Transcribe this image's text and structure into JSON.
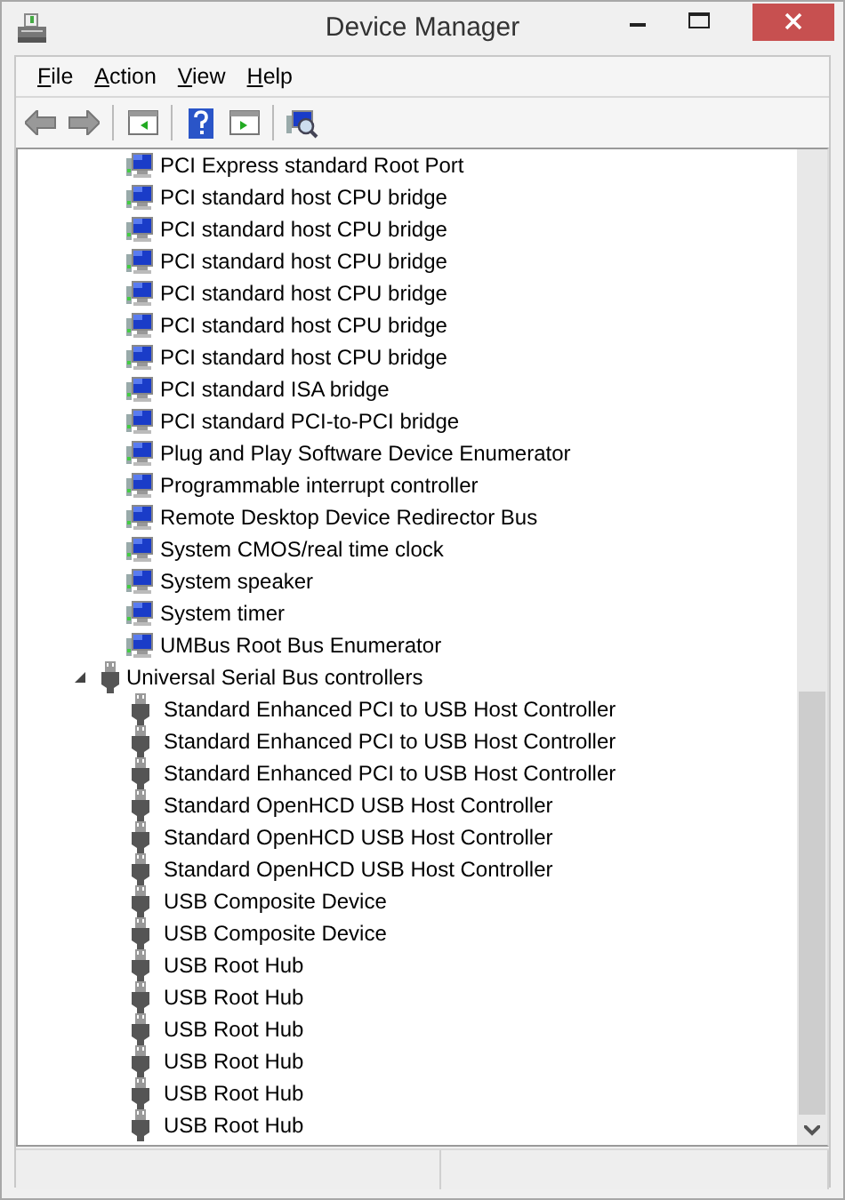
{
  "window": {
    "title": "Device Manager"
  },
  "menu": [
    "File",
    "Action",
    "View",
    "Help"
  ],
  "toolbar": [
    {
      "kind": "back"
    },
    {
      "kind": "forward"
    },
    {
      "kind": "separator"
    },
    {
      "kind": "console-tree"
    },
    {
      "kind": "separator"
    },
    {
      "kind": "help"
    },
    {
      "kind": "action-pane"
    },
    {
      "kind": "separator"
    },
    {
      "kind": "scan"
    }
  ],
  "tree": [
    {
      "kind": "system",
      "children": [
        {
          "label": "PCI Express standard Root Port"
        },
        {
          "label": "PCI standard host CPU bridge"
        },
        {
          "label": "PCI standard host CPU bridge"
        },
        {
          "label": "PCI standard host CPU bridge"
        },
        {
          "label": "PCI standard host CPU bridge"
        },
        {
          "label": "PCI standard host CPU bridge"
        },
        {
          "label": "PCI standard host CPU bridge"
        },
        {
          "label": "PCI standard ISA bridge"
        },
        {
          "label": "PCI standard PCI-to-PCI bridge"
        },
        {
          "label": "Plug and Play Software Device Enumerator"
        },
        {
          "label": "Programmable interrupt controller"
        },
        {
          "label": "Remote Desktop Device Redirector Bus"
        },
        {
          "label": "System CMOS/real time clock"
        },
        {
          "label": "System speaker"
        },
        {
          "label": "System timer"
        },
        {
          "label": "UMBus Root Bus Enumerator"
        }
      ]
    },
    {
      "kind": "usb",
      "label": "Universal Serial Bus controllers",
      "expanded": true,
      "children": [
        {
          "label": "Standard Enhanced PCI to USB Host Controller"
        },
        {
          "label": "Standard Enhanced PCI to USB Host Controller"
        },
        {
          "label": "Standard Enhanced PCI to USB Host Controller"
        },
        {
          "label": "Standard OpenHCD USB Host Controller"
        },
        {
          "label": "Standard OpenHCD USB Host Controller"
        },
        {
          "label": "Standard OpenHCD USB Host Controller"
        },
        {
          "label": "USB Composite Device"
        },
        {
          "label": "USB Composite Device"
        },
        {
          "label": "USB Root Hub"
        },
        {
          "label": "USB Root Hub"
        },
        {
          "label": "USB Root Hub"
        },
        {
          "label": "USB Root Hub"
        },
        {
          "label": "USB Root Hub"
        },
        {
          "label": "USB Root Hub"
        }
      ]
    }
  ]
}
